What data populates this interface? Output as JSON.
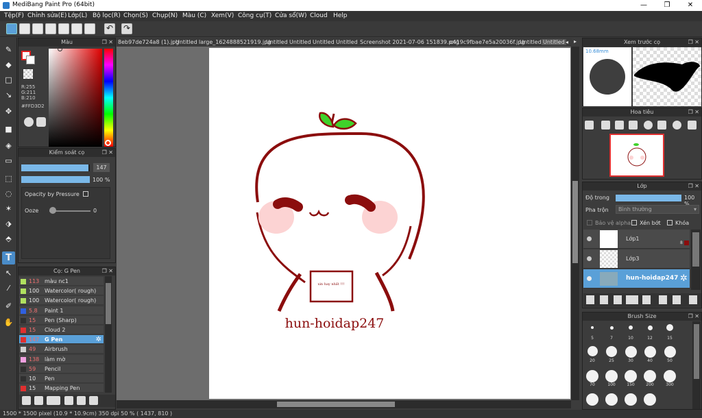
{
  "window": {
    "title": "MediBang Paint Pro (64bit)",
    "minimize": "—",
    "maximize": "❐",
    "close": "✕"
  },
  "menu": [
    "Tệp(F)",
    "Chỉnh sửa(E)",
    "Lớp(L)",
    "Bộ lọc(R)",
    "Chọn(S)",
    "Chụp(N)",
    "Màu (C)",
    "Xem(V)",
    "Công cụ(T)",
    "Cửa sổ(W)",
    "Cloud",
    "Help"
  ],
  "tabs": [
    "8eb97de724a8 (1).jpg",
    "Untitled",
    "large_1624888521919.jpg",
    "Untitled",
    "Untitled",
    "Untitled",
    "Untitled",
    "Screenshot 2021-07-06 151839.png",
    "c419c9fbae7e5a20036f.jpg",
    "Untitled",
    "Untitled"
  ],
  "tab_nav": {
    "prev": "◂",
    "next": "▸",
    "close": "✕"
  },
  "color_panel": {
    "title": "Màu",
    "r": "R:255",
    "g": "G:211",
    "b": "B:210",
    "hex": "#FFD3D2",
    "fg": "#e02020",
    "bg": "#ffffff"
  },
  "brush_control": {
    "title": "Kiểm soát cọ",
    "size": "147",
    "opacity": "100 %",
    "size_fraction": 0.98,
    "opacity_fraction": 1.0,
    "pressure_label": "Opacity by Pressure",
    "ooze_label": "Ooze",
    "ooze_value": "0"
  },
  "brush_list": {
    "title": "Cọ: G Pen",
    "items": [
      {
        "n": "113",
        "l": "màu nc1",
        "c": "#b0e060",
        "red": true
      },
      {
        "n": "100",
        "l": "Watercolor( rough)",
        "c": "#b0e060",
        "red": false
      },
      {
        "n": "100",
        "l": "Watercolor( rough)",
        "c": "#b0e060",
        "red": false
      },
      {
        "n": "5.8",
        "l": "Paint 1",
        "c": "#3060e0",
        "red": true
      },
      {
        "n": "15",
        "l": "Pen (Sharp)",
        "c": "#303030",
        "red": true
      },
      {
        "n": "15",
        "l": "Cloud 2",
        "c": "#e03030",
        "red": true
      },
      {
        "n": "147",
        "l": "G Pen",
        "c": "#e03030",
        "red": true,
        "sel": true
      },
      {
        "n": "49",
        "l": "Airbrush",
        "c": "#d0d0d0",
        "red": true
      },
      {
        "n": "138",
        "l": "làm mờ",
        "c": "#f0a0e0",
        "red": true
      },
      {
        "n": "59",
        "l": "Pencil",
        "c": "#303030",
        "red": true
      },
      {
        "n": "10",
        "l": "Pen",
        "c": "#303030",
        "red": false
      },
      {
        "n": "15",
        "l": "Mapping Pen",
        "c": "#e03030",
        "red": false
      }
    ]
  },
  "preview": {
    "title": "Xem trước cọ",
    "size": "10.68mm"
  },
  "navigator": {
    "title": "Hoa tiêu"
  },
  "layer_panel": {
    "title": "Lớp",
    "opacity_label": "Độ trong",
    "opacity": "100 %",
    "opacity_fraction": 1.0,
    "blend_label": "Pha trộn",
    "blend": "Bình thường",
    "protect": "Bảo vệ alpha",
    "clip": "Xén bớt",
    "lock": "Khóa",
    "layers": [
      {
        "name": "Lớp1",
        "badge": "8"
      },
      {
        "name": "Lớp3"
      },
      {
        "name": "hun-hoidap247",
        "sel": true
      }
    ]
  },
  "brush_size": {
    "title": "Brush Size",
    "labels": [
      "5",
      "7",
      "10",
      "12",
      "15",
      "20",
      "25",
      "30",
      "40",
      "50",
      "70",
      "100",
      "150",
      "200",
      "300"
    ]
  },
  "canvas": {
    "note": "xin hay nhất !!!",
    "watermark": "hun-hoidap247"
  },
  "status": "1500 * 1500 pixel  (10.9 * 10.9cm)  350 dpi  50 %  ( 1437, 810 )"
}
